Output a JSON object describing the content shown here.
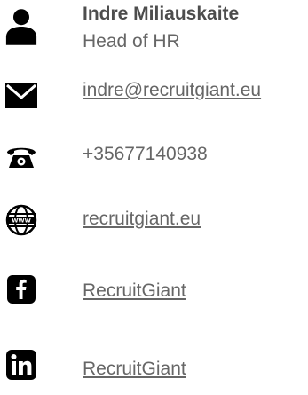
{
  "contact": {
    "name": "Indre Miliauskaite",
    "role": "Head of HR",
    "email": "indre@recruitgiant.eu",
    "phone": "+35677140938",
    "website": "recruitgiant.eu",
    "facebook": "RecruitGiant",
    "linkedin": "RecruitGiant"
  },
  "icons": {
    "person": "person-icon",
    "email": "envelope-icon",
    "phone": "telephone-icon",
    "website": "globe-www-icon",
    "facebook": "facebook-icon",
    "linkedin": "linkedin-icon"
  },
  "colors": {
    "icon": "#000000",
    "text": "#4d4d4d",
    "secondary_text": "#666666"
  }
}
